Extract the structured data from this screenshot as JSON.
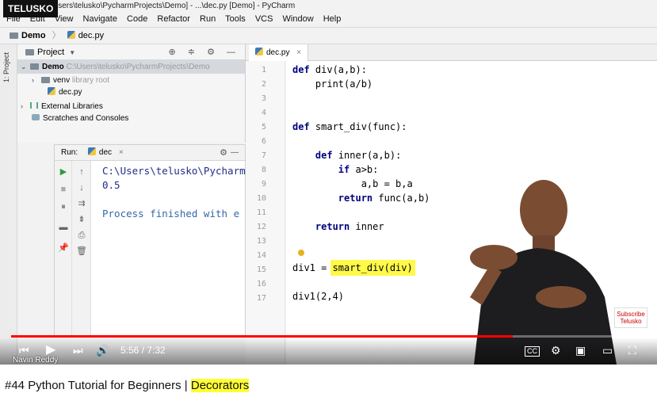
{
  "channel": {
    "logo": "TELUSKO",
    "creator": "Navin Reddy"
  },
  "ide": {
    "title": "Users\\telusko\\PycharmProjects\\Demo] - ...\\dec.py [Demo] - PyCharm",
    "menu": [
      "File",
      "Edit",
      "View",
      "Navigate",
      "Code",
      "Refactor",
      "Run",
      "Tools",
      "VCS",
      "Window",
      "Help"
    ],
    "breadcrumb": {
      "project": "Demo",
      "file": "dec.py"
    },
    "left_stripe_label": "1: Project",
    "project_panel": {
      "header": "Project",
      "tree": [
        {
          "label": "Demo",
          "extra": "C:\\Users\\telusko\\PycharmProjects\\Demo"
        },
        {
          "label": "venv",
          "extra": "library root"
        },
        {
          "label": "dec.py",
          "extra": ""
        },
        {
          "label": "External Libraries",
          "extra": ""
        },
        {
          "label": "Scratches and Consoles",
          "extra": ""
        }
      ]
    },
    "run_panel": {
      "label": "Run:",
      "config": "dec",
      "output": [
        "C:\\Users\\telusko\\Pycharm",
        "0.5",
        "",
        "Process finished with e"
      ]
    },
    "editor": {
      "tab": "dec.py",
      "line_numbers": [
        "1",
        "2",
        "3",
        "4",
        "5",
        "6",
        "7",
        "8",
        "9",
        "10",
        "11",
        "12",
        "13",
        "14",
        "15",
        "16",
        "17"
      ],
      "code": {
        "l1_kw": "def",
        "l1_rest": " div(a,b):",
        "l2": "    print(a/b)",
        "l5_kw": "def",
        "l5_rest": " smart_div(func):",
        "l7_kw": "def",
        "l7_rest": " inner(a,b):",
        "l8_kw": "if",
        "l8_rest": " a>b:",
        "l9": "a,b = b,a",
        "l10_kw": "return",
        "l10_rest": " func(a,b)",
        "l12_kw": "return",
        "l12_rest": " inner",
        "l15_pre": "div1 = ",
        "l15_hl": "smart_div(div)",
        "l17": "div1(2,4)"
      }
    }
  },
  "video": {
    "time_current": "5:56",
    "time_total": "7:32",
    "time_display": "5:56 / 7:32",
    "progress_fraction": 0.79,
    "subscribe_line1": "Subscribe",
    "subscribe_line2": "Telusko"
  },
  "page": {
    "title_prefix": "#44 Python Tutorial for Beginners | ",
    "title_highlight": "Decorators"
  }
}
